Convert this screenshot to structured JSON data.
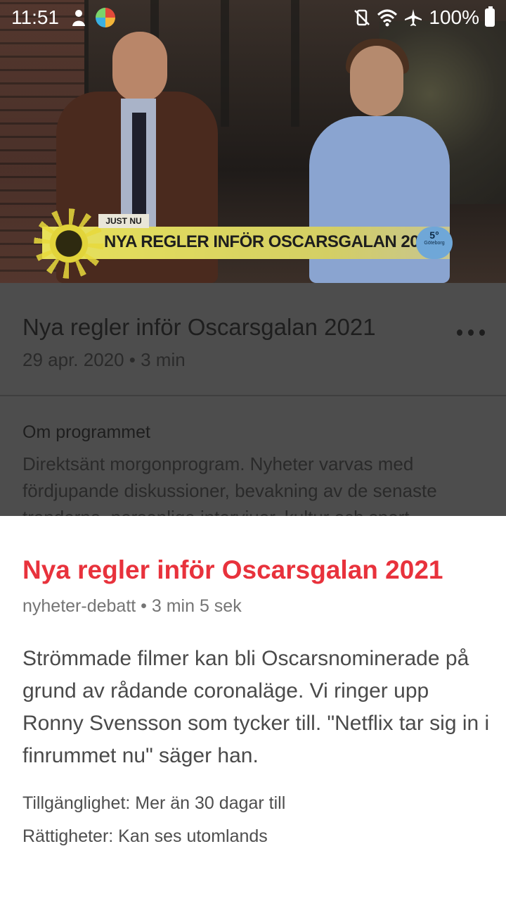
{
  "status_bar": {
    "time": "11:51",
    "battery_percent": "100%",
    "left_icons": [
      "notification-icon",
      "app-icon"
    ],
    "right_icons": [
      "vibrate-icon",
      "wifi-icon",
      "airplane-icon",
      "battery-charging-icon"
    ]
  },
  "video": {
    "badge": "JUST NU",
    "headline": "NYA REGLER INFÖR OSCARSGALAN 2021",
    "weather_temp": "5°",
    "weather_city": "Göteborg"
  },
  "episode": {
    "title": "Nya regler inför Oscarsgalan 2021",
    "meta": "29 apr. 2020 • 3 min",
    "more_icon": "more-horizontal-icon"
  },
  "about": {
    "heading": "Om programmet",
    "body": "Direktsänt morgonprogram. Nyheter varvas med fördjupande diskussioner, bevakning av de senaste trenderna, personliga intervjuer, kultur och sport."
  },
  "sheet": {
    "title": "Nya regler inför Oscarsgalan 2021",
    "meta": "nyheter-debatt • 3 min 5 sek",
    "description": "Strömmade filmer kan bli Oscarsnominerade på grund av rådande coronaläge. Vi ringer upp Ronny Svensson som tycker till. \"Netflix tar sig in i finrummet nu\" säger han.",
    "availability": "Tillgänglighet: Mer än 30 dagar till",
    "rights": "Rättigheter: Kan ses utomlands",
    "accent_color": "#e8323c"
  }
}
